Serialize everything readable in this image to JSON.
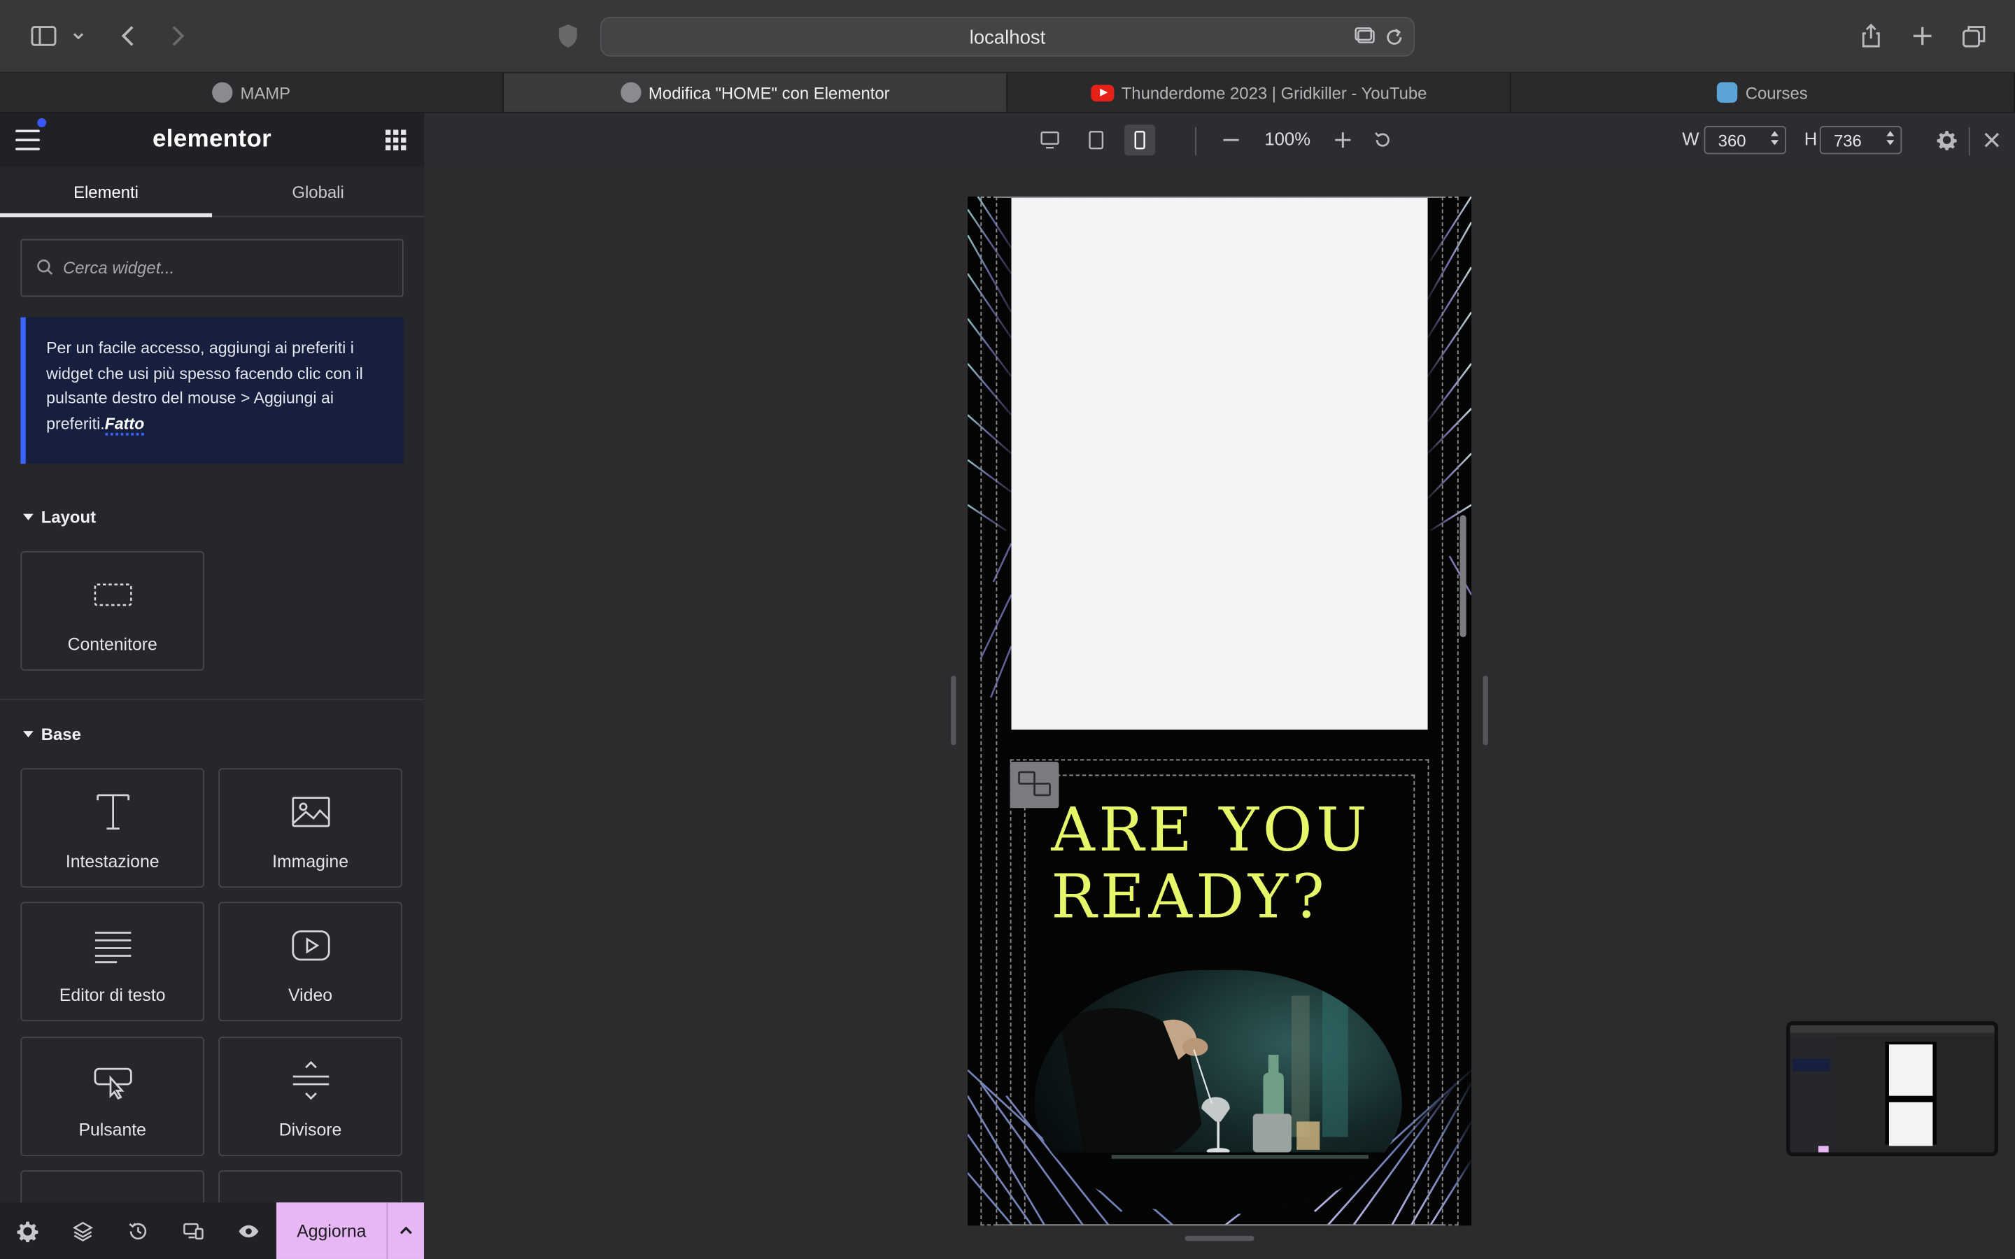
{
  "browser": {
    "url": "localhost",
    "tabs": [
      {
        "label": "MAMP",
        "active": false,
        "favicon": "mamp-icon"
      },
      {
        "label": "Modifica \"HOME\" con Elementor",
        "active": true,
        "favicon": "mamp-icon"
      },
      {
        "label": "Thunderdome 2023 | Gridkiller - YouTube",
        "active": false,
        "favicon": "youtube-icon"
      },
      {
        "label": "Courses",
        "active": false,
        "favicon": "courses-icon"
      }
    ]
  },
  "panel": {
    "brand": "elementor",
    "tabs": [
      {
        "label": "Elementi",
        "active": true
      },
      {
        "label": "Globali",
        "active": false
      }
    ],
    "search_placeholder": "Cerca widget...",
    "notice": {
      "text": "Per un facile accesso, aggiungi ai preferiti i widget che usi più spesso facendo clic con il pulsante destro del mouse > Aggiungi ai preferiti.",
      "action": "Fatto"
    },
    "sections": {
      "layout": {
        "title": "Layout",
        "widgets": [
          {
            "label": "Contenitore",
            "icon": "container-icon"
          }
        ]
      },
      "base": {
        "title": "Base",
        "widgets": [
          {
            "label": "Intestazione",
            "icon": "heading-icon"
          },
          {
            "label": "Immagine",
            "icon": "image-icon"
          },
          {
            "label": "Editor di testo",
            "icon": "text-editor-icon"
          },
          {
            "label": "Video",
            "icon": "video-icon"
          },
          {
            "label": "Pulsante",
            "icon": "button-icon"
          },
          {
            "label": "Divisore",
            "icon": "divider-icon"
          }
        ]
      }
    },
    "footer": {
      "update_label": "Aggiorna"
    }
  },
  "responsive_bar": {
    "zoom": "100%",
    "width_label": "W",
    "width_value": "360",
    "height_label": "H",
    "height_value": "736",
    "active_device": "mobile"
  },
  "preview": {
    "heading_line1": "ARE YOU",
    "heading_line2": "READY?",
    "accent_color": "#e7f76a"
  }
}
